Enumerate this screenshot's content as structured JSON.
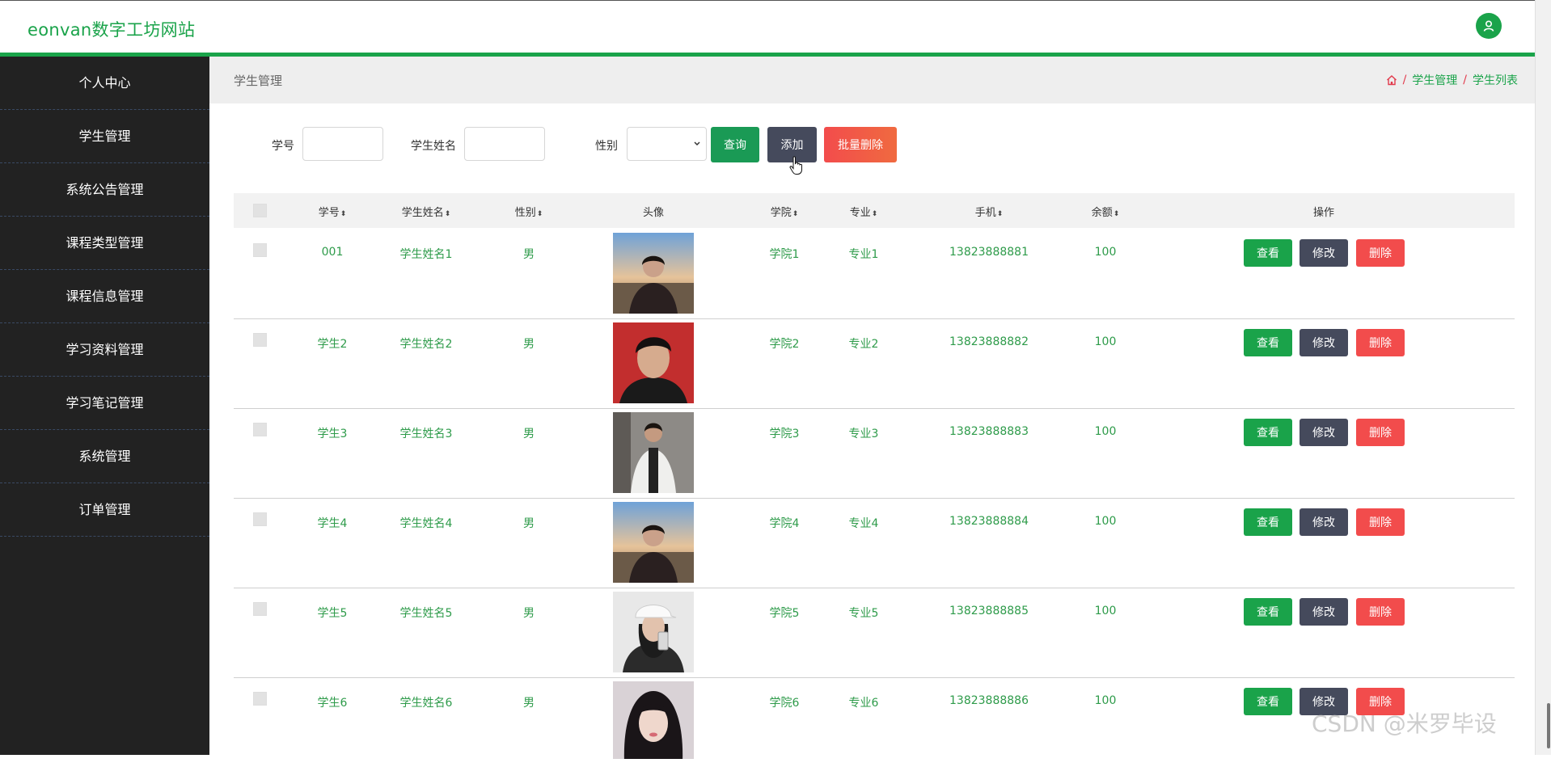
{
  "header": {
    "site_title": "eonvan数字工坊网站"
  },
  "sidebar": {
    "items": [
      {
        "label": "个人中心"
      },
      {
        "label": "学生管理"
      },
      {
        "label": "系统公告管理"
      },
      {
        "label": "课程类型管理"
      },
      {
        "label": "课程信息管理"
      },
      {
        "label": "学习资料管理"
      },
      {
        "label": "学习笔记管理"
      },
      {
        "label": "系统管理"
      },
      {
        "label": "订单管理"
      }
    ]
  },
  "page": {
    "title": "学生管理",
    "breadcrumb": [
      "学生管理",
      "学生列表"
    ]
  },
  "search": {
    "id_label": "学号",
    "name_label": "学生姓名",
    "gender_label": "性别",
    "query_button": "查询",
    "add_button": "添加",
    "batch_delete_button": "批量删除"
  },
  "table": {
    "headers": [
      "学号",
      "学生姓名",
      "性别",
      "头像",
      "学院",
      "专业",
      "手机",
      "余额",
      "操作"
    ],
    "rows": [
      {
        "id": "001",
        "name": "学生姓名1",
        "gender": "男",
        "college": "学院1",
        "major": "专业1",
        "phone": "13823888881",
        "balance": "100"
      },
      {
        "id": "学生2",
        "name": "学生姓名2",
        "gender": "男",
        "college": "学院2",
        "major": "专业2",
        "phone": "13823888882",
        "balance": "100"
      },
      {
        "id": "学生3",
        "name": "学生姓名3",
        "gender": "男",
        "college": "学院3",
        "major": "专业3",
        "phone": "13823888883",
        "balance": "100"
      },
      {
        "id": "学生4",
        "name": "学生姓名4",
        "gender": "男",
        "college": "学院4",
        "major": "专业4",
        "phone": "13823888884",
        "balance": "100"
      },
      {
        "id": "学生5",
        "name": "学生姓名5",
        "gender": "男",
        "college": "学院5",
        "major": "专业5",
        "phone": "13823888885",
        "balance": "100"
      },
      {
        "id": "学生6",
        "name": "学生姓名6",
        "gender": "男",
        "college": "学院6",
        "major": "专业6",
        "phone": "13823888886",
        "balance": "100"
      }
    ],
    "actions": {
      "view": "查看",
      "edit": "修改",
      "delete": "删除"
    }
  },
  "watermark": "CSDN @米罗毕设",
  "colors": {
    "accent": "#1aa34a",
    "sidebar_bg": "#222222",
    "danger": "#f24c4c",
    "edit": "#454a5c"
  }
}
